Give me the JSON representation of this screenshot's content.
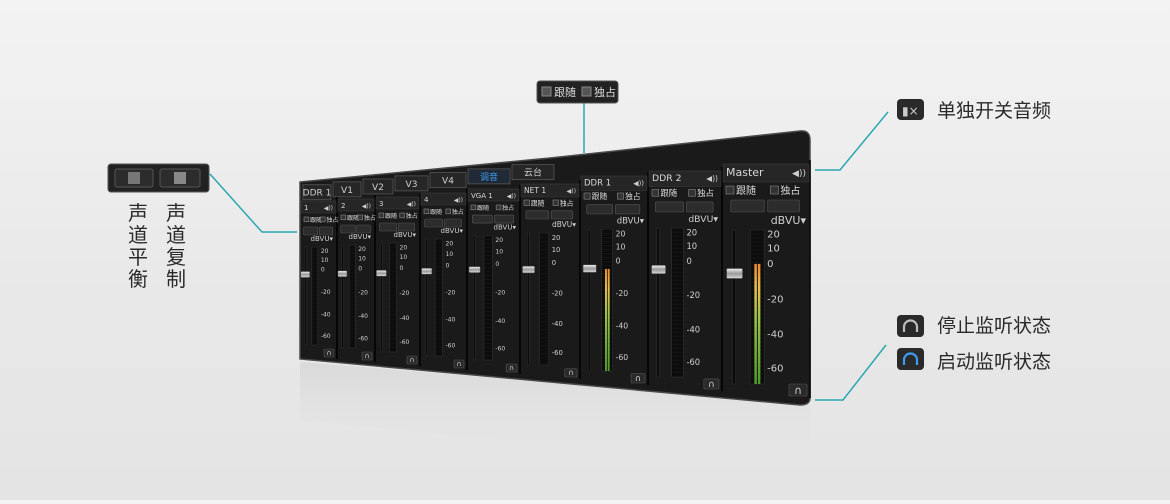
{
  "top_callout": {
    "follow_label": "跟随",
    "exclusive_label": "独占"
  },
  "right_callouts": {
    "mute_toggle": "单独开关音频",
    "stop_monitor": "停止监听状态",
    "start_monitor": "启动监听状态"
  },
  "left_callouts": {
    "channel_balance": [
      "声",
      "道",
      "平",
      "衡"
    ],
    "channel_copy": [
      "声",
      "道",
      "复",
      "制"
    ]
  },
  "mixer": {
    "tabs": [
      {
        "label": "DDR 1",
        "active": false
      },
      {
        "label": "V1",
        "active": false
      },
      {
        "label": "V2",
        "active": false
      },
      {
        "label": "V3",
        "active": false
      },
      {
        "label": "V4",
        "active": false
      },
      {
        "label": "调音",
        "active": true
      },
      {
        "label": "云台",
        "active": false
      }
    ],
    "channels": [
      {
        "name": "1"
      },
      {
        "name": "2"
      },
      {
        "name": "3"
      },
      {
        "name": "4"
      },
      {
        "name": "VGA 1"
      },
      {
        "name": "NET 1"
      },
      {
        "name": "DDR 1"
      },
      {
        "name": "DDR 2"
      },
      {
        "name": "Master"
      }
    ],
    "follow_label": "跟随",
    "exclusive_label": "独占",
    "meter_unit": "dBVU",
    "scale": [
      "20",
      "10",
      "0",
      "-20",
      "-40",
      "-60"
    ],
    "levels": [
      0,
      0,
      0,
      0,
      0,
      0,
      0.72,
      0,
      0.78
    ],
    "colors": {
      "active_tab": "#3f9cf0",
      "panel": "#1b1b1b",
      "accent": "#2aa7b0"
    }
  }
}
